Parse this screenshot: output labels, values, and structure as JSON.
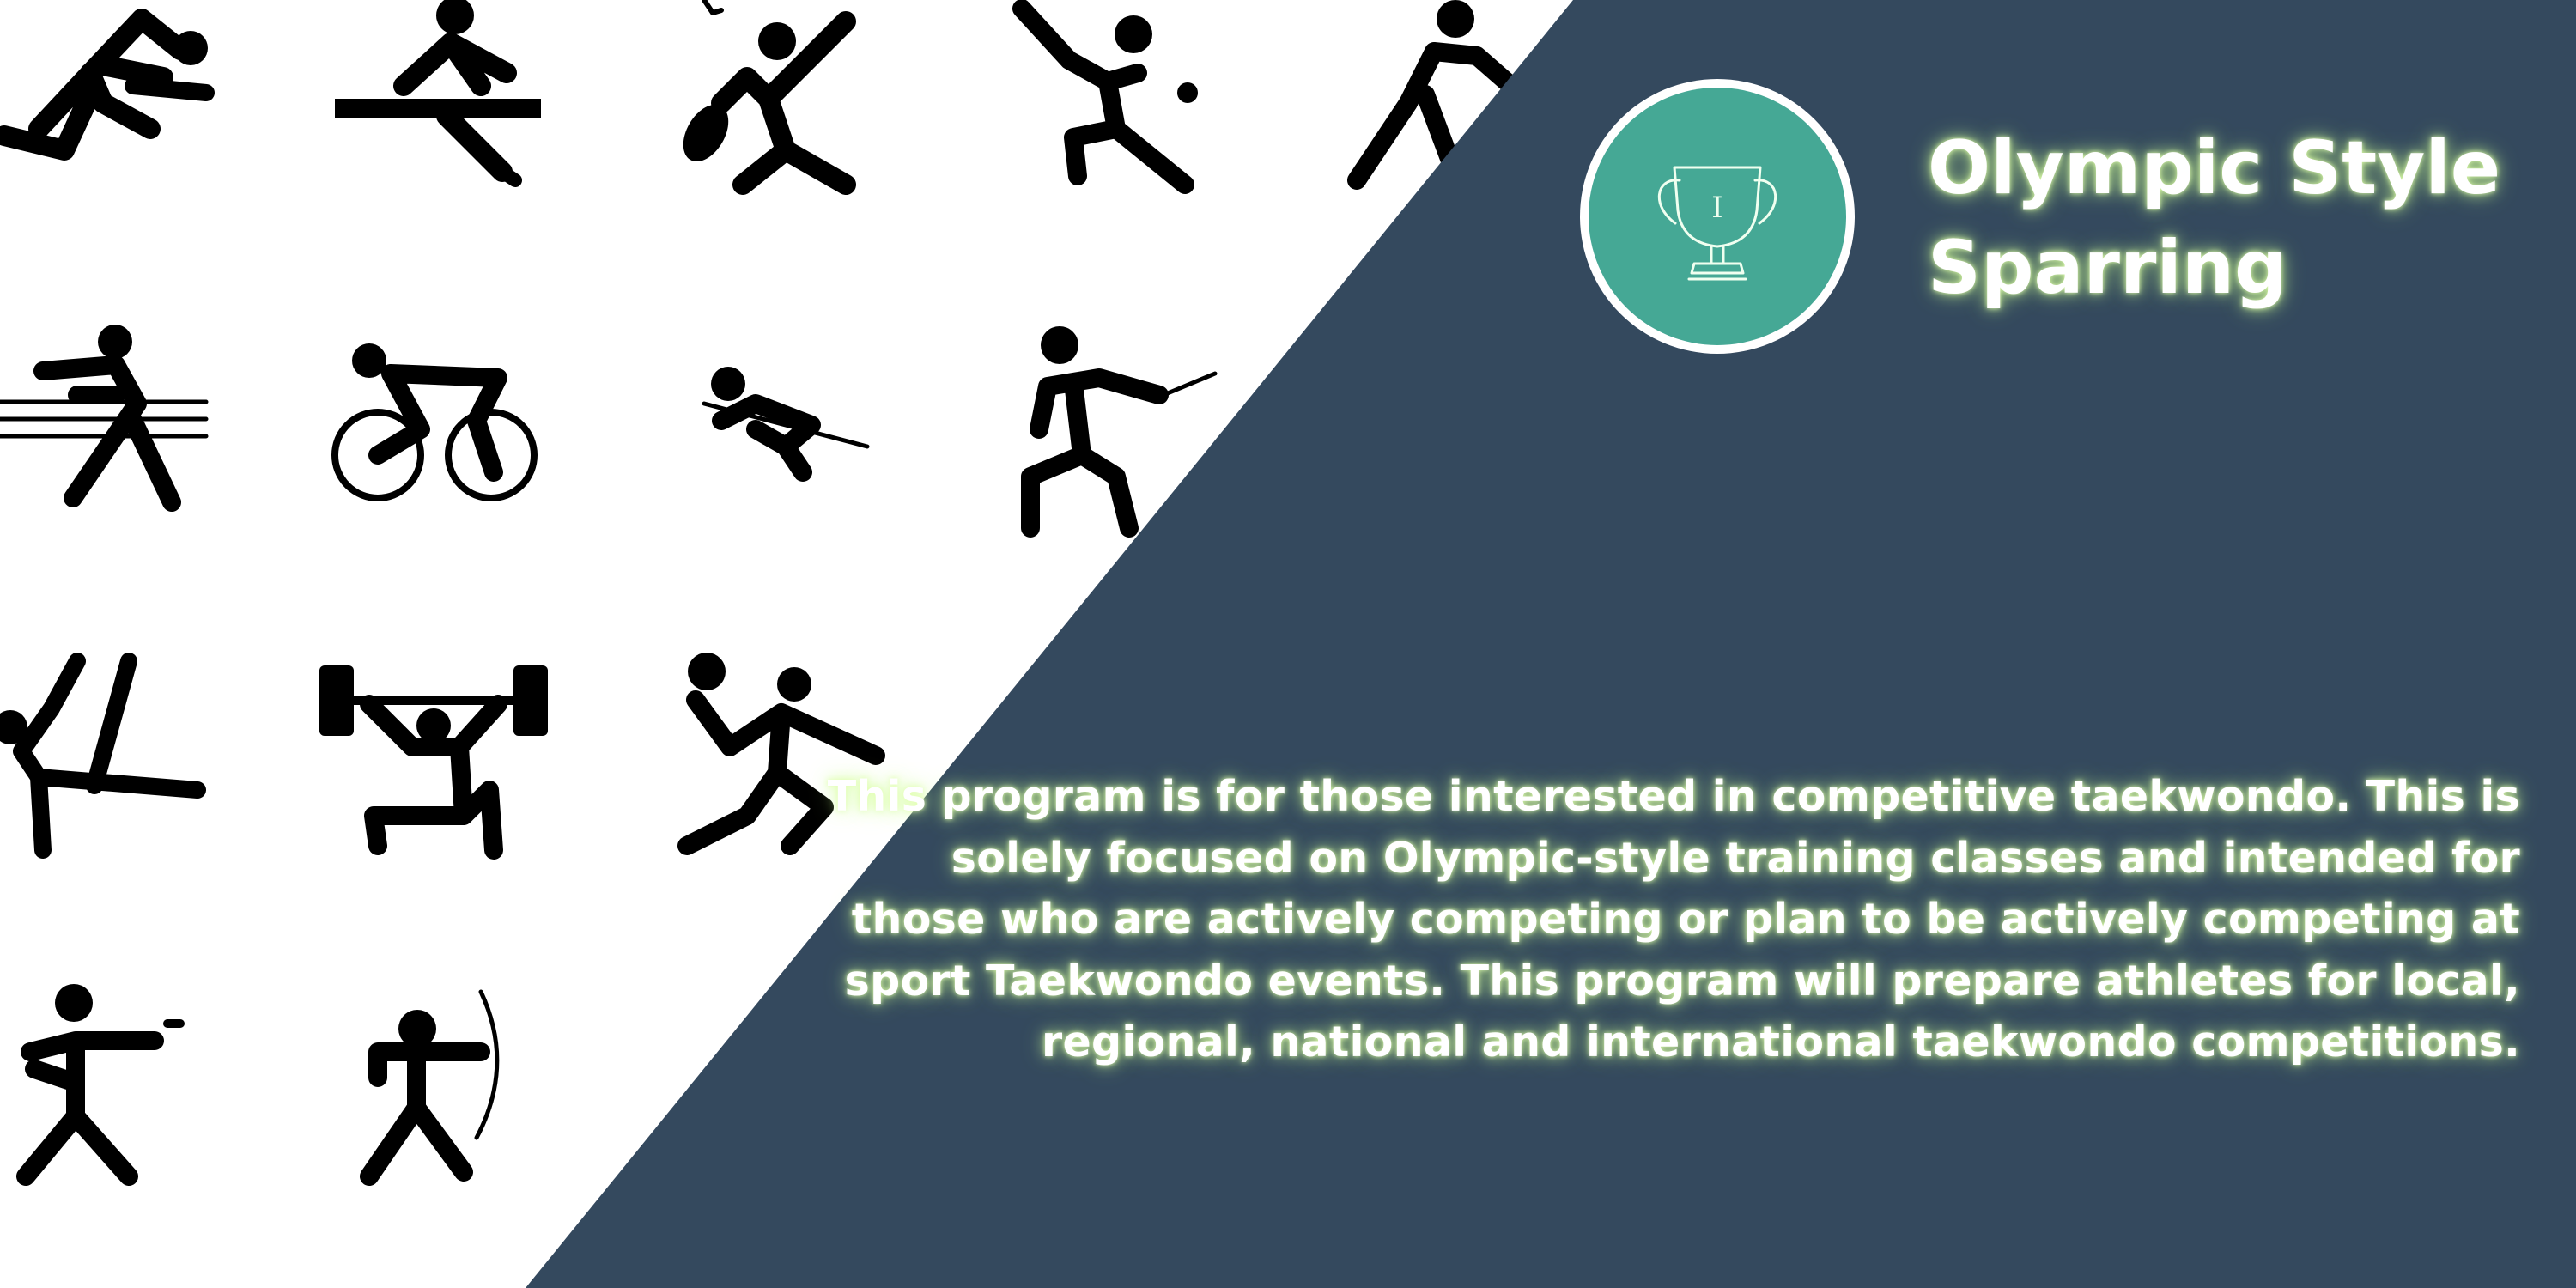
{
  "banner": {
    "title": "Olympic Style Sparring",
    "description": "This program is for those interested in competitive taekwondo. This is solely focused on Olympic-style training classes and intended for those who are actively competing or plan to be actively competing at sport Taekwondo events. This program will prepare athletes for local, regional, national and international taekwondo competitions.",
    "trophy_initial": "I"
  },
  "colors": {
    "panel": "#34495e",
    "badge_fill": "#45a895",
    "badge_ring": "#ffffff",
    "text_glow": "#d8ffa0",
    "pictogram": "#000000"
  },
  "pictograms": [
    "sprinter-icon",
    "rowing-icon",
    "badminton-icon",
    "baseball-batter-icon",
    "walker-icon",
    "boxing-icon",
    "cycling-icon",
    "diving-icon",
    "fencing-icon",
    "gymnastics-icon",
    "weightlifting-icon",
    "handball-icon",
    "shooting-icon",
    "archery-icon"
  ]
}
